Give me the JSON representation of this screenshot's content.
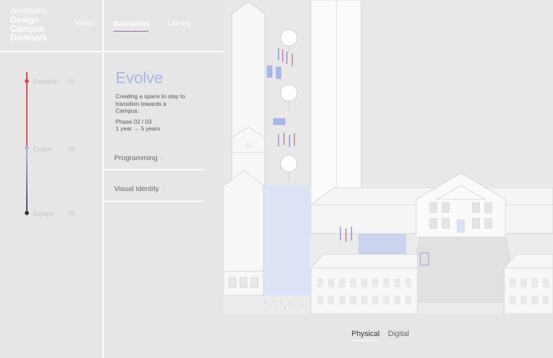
{
  "logo": {
    "line1": "developing",
    "line2": "Design",
    "line3": "Campus",
    "line4": "Denmark"
  },
  "nav": {
    "items": [
      {
        "label": "Vision",
        "active": false
      },
      {
        "label": "Scenarios",
        "active": true
      },
      {
        "label": "Library",
        "active": false
      }
    ]
  },
  "timeline": {
    "phases": [
      {
        "label": "Establish",
        "num": "01",
        "color": "#e0454f"
      },
      {
        "label": "Evolve",
        "num": "02",
        "color": "#a9b6e6"
      },
      {
        "label": "Expand",
        "num": "03",
        "color": "#3a2a3e"
      }
    ]
  },
  "content": {
    "title": "Evolve",
    "description": "Creating a space to stay to transition towards a Campus.",
    "phase": "Phase 02 / 03",
    "duration": "1 year → 5 years",
    "menu": [
      {
        "label": "Programming",
        "chevron": "›"
      },
      {
        "label": "Visual Identity",
        "chevron": "›"
      }
    ]
  },
  "view_toggle": {
    "options": [
      {
        "label": "Physical",
        "active": true
      },
      {
        "label": "Digital",
        "active": false
      }
    ]
  },
  "colors": {
    "background": "#e6e6e6",
    "accent_blue": "#a9b6e6",
    "accent_red": "#e0454f",
    "dark_purple": "#3a2a3e",
    "line": "#ffffff"
  }
}
